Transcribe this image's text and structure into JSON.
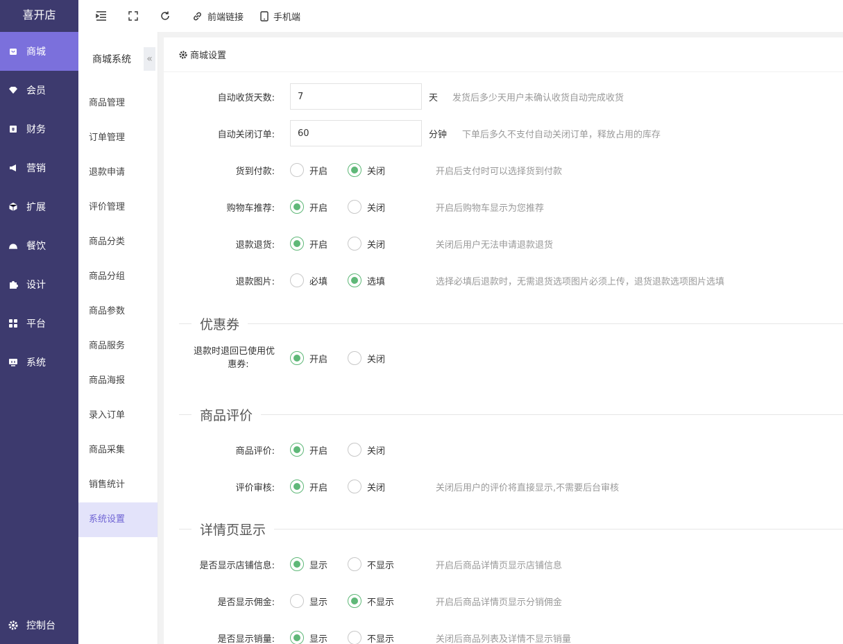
{
  "app": {
    "logo": "喜开店"
  },
  "nav": {
    "items": [
      {
        "label": "商城",
        "icon": "shop-icon"
      },
      {
        "label": "会员",
        "icon": "diamond-icon"
      },
      {
        "label": "财务",
        "icon": "finance-icon"
      },
      {
        "label": "营销",
        "icon": "megaphone-icon"
      },
      {
        "label": "扩展",
        "icon": "cube-icon"
      },
      {
        "label": "餐饮",
        "icon": "dish-icon"
      },
      {
        "label": "设计",
        "icon": "puzzle-icon"
      },
      {
        "label": "平台",
        "icon": "grid-icon"
      },
      {
        "label": "系统",
        "icon": "monitor-icon"
      }
    ],
    "active_index": 0,
    "footer": "控制台"
  },
  "topbar": {
    "link_label": "前端链接",
    "mobile_label": "手机端"
  },
  "subnav": {
    "title": "商城系统",
    "collapse_glyph": "«",
    "items": [
      "商品管理",
      "订单管理",
      "退款申请",
      "评价管理",
      "商品分类",
      "商品分组",
      "商品参数",
      "商品服务",
      "商品海报",
      "录入订单",
      "商品采集",
      "销售统计",
      "系统设置"
    ],
    "active_index": 12
  },
  "panel": {
    "title": "商城设置"
  },
  "form": {
    "auto_receive": {
      "label": "自动收货天数:",
      "value": "7",
      "unit": "天",
      "hint": "发货后多少天用户未确认收货自动完成收货"
    },
    "auto_close": {
      "label": "自动关闭订单:",
      "value": "60",
      "unit": "分钟",
      "hint": "下单后多久不支付自动关闭订单，释放占用的库存"
    },
    "cod": {
      "label": "货到付款:",
      "opt1": "开启",
      "opt2": "关闭",
      "selected": 2,
      "hint": "开启后支付时可以选择货到付款"
    },
    "cart_recommend": {
      "label": "购物车推荐:",
      "opt1": "开启",
      "opt2": "关闭",
      "selected": 1,
      "hint": "开启后购物车显示为您推荐"
    },
    "refund_return": {
      "label": "退款退货:",
      "opt1": "开启",
      "opt2": "关闭",
      "selected": 1,
      "hint": "关闭后用户无法申请退款退货"
    },
    "refund_image": {
      "label": "退款图片:",
      "opt1": "必填",
      "opt2": "选填",
      "selected": 2,
      "hint": "选择必填后退款时，无需退货选项图片必须上传，退货退款选项图片选填"
    },
    "coupon_section": "优惠券",
    "coupon_return": {
      "label_line1": "退款时退回已使用优",
      "label_line2": "惠券:",
      "opt1": "开启",
      "opt2": "关闭",
      "selected": 1
    },
    "review_section": "商品评价",
    "review": {
      "label": "商品评价:",
      "opt1": "开启",
      "opt2": "关闭",
      "selected": 1
    },
    "review_audit": {
      "label": "评价审核:",
      "opt1": "开启",
      "opt2": "关闭",
      "selected": 1,
      "hint": "关闭后用户的评价将直接显示,不需要后台审核"
    },
    "detail_section": "详情页显示",
    "show_shop": {
      "label": "是否显示店铺信息:",
      "opt1": "显示",
      "opt2": "不显示",
      "selected": 1,
      "hint": "开启后商品详情页显示店铺信息"
    },
    "show_commission": {
      "label": "是否显示佣金:",
      "opt1": "显示",
      "opt2": "不显示",
      "selected": 2,
      "hint": "开启后商品详情页显示分销佣金"
    },
    "show_sales": {
      "label": "是否显示销量:",
      "opt1": "显示",
      "opt2": "不显示",
      "selected": 1,
      "hint": "关闭后商品列表及详情不显示销量"
    }
  },
  "colors": {
    "nav_bg": "#3d3a6e",
    "nav_active": "#7b70dc",
    "radio_on": "#5fb878",
    "sub_active_bg": "#e3e3fa",
    "sub_active_text": "#6f64d4"
  }
}
